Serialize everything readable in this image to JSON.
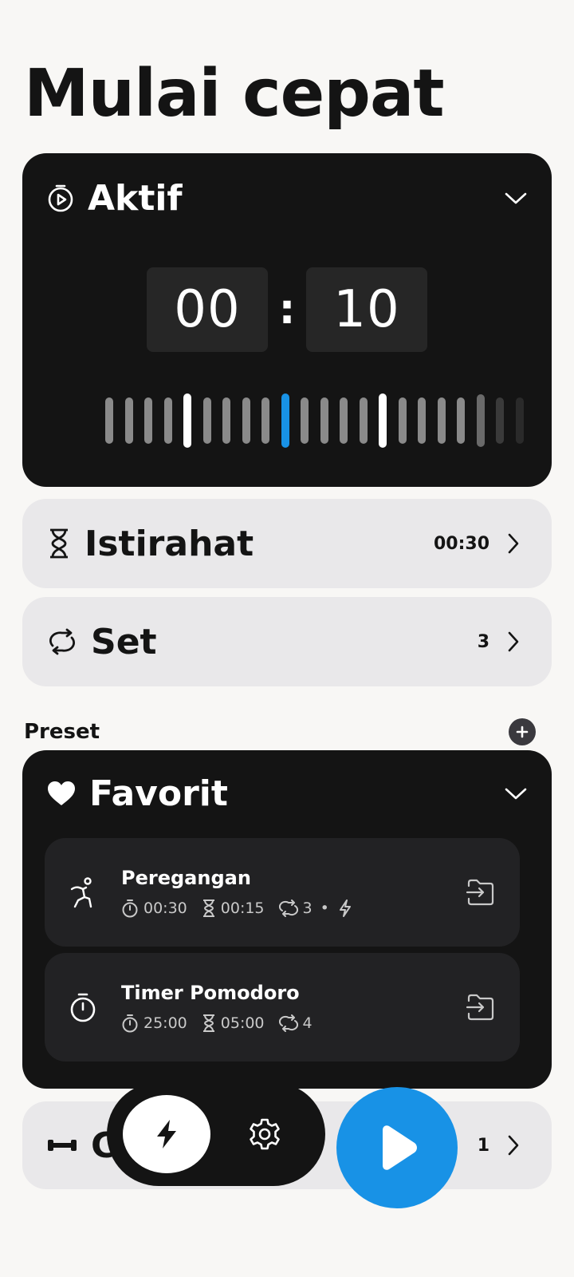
{
  "page": {
    "title": "Mulai cepat"
  },
  "active": {
    "title": "Aktif",
    "minutes": "00",
    "separator": ":",
    "seconds": "10"
  },
  "rest": {
    "label": "Istirahat",
    "value": "00:30"
  },
  "sets": {
    "label": "Set",
    "value": "3"
  },
  "presets": {
    "label": "Preset"
  },
  "favorites": {
    "title": "Favorit",
    "items": [
      {
        "name": "Peregangan",
        "icon": "stretch-icon",
        "active": "00:30",
        "rest": "00:15",
        "sets": "3",
        "separator": "•"
      },
      {
        "name": "Timer Pomodoro",
        "icon": "stopwatch-icon",
        "active": "25:00",
        "rest": "05:00",
        "sets": "4"
      }
    ]
  },
  "hidden_row": {
    "label_partial": "C",
    "value": "1"
  },
  "colors": {
    "accent": "#1892e6",
    "dark_card": "#141414",
    "light_card": "#e9e8ea",
    "background": "#f8f7f5"
  }
}
